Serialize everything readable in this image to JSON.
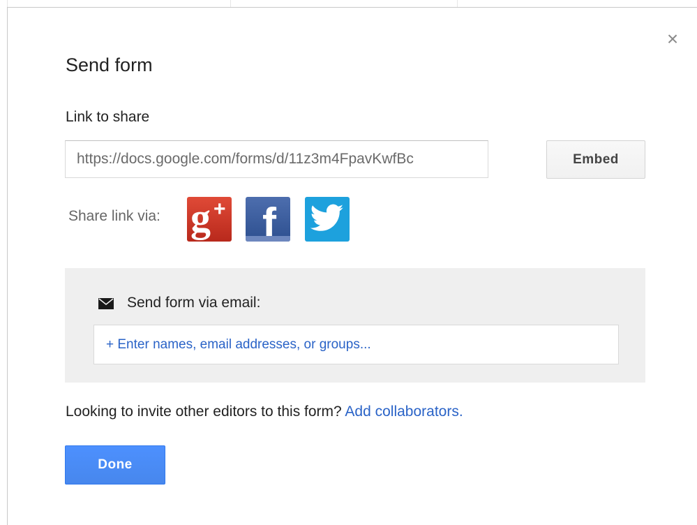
{
  "dialog": {
    "title": "Send form",
    "close_label": "×"
  },
  "link": {
    "label": "Link to share",
    "url_value": "https://docs.google.com/forms/d/11z3m4FpavKwfBc",
    "embed_label": "Embed"
  },
  "share": {
    "label": "Share link via:",
    "networks": [
      {
        "name": "google-plus",
        "glyph": "g+",
        "color": "#d73d32"
      },
      {
        "name": "facebook",
        "glyph": "f",
        "color": "#3b5998"
      },
      {
        "name": "twitter",
        "glyph": "twitter-bird",
        "color": "#1da1dd"
      }
    ]
  },
  "email": {
    "label": "Send form via email:",
    "icon": "envelope-icon",
    "placeholder": "+ Enter names, email addresses, or groups..."
  },
  "collaborators": {
    "prompt": "Looking to invite other editors to this form?",
    "link_label": "Add collaborators."
  },
  "actions": {
    "done_label": "Done"
  },
  "colors": {
    "primary_button": "#4d90fe",
    "link": "#2a63c7",
    "email_panel_bg": "#efefef"
  }
}
